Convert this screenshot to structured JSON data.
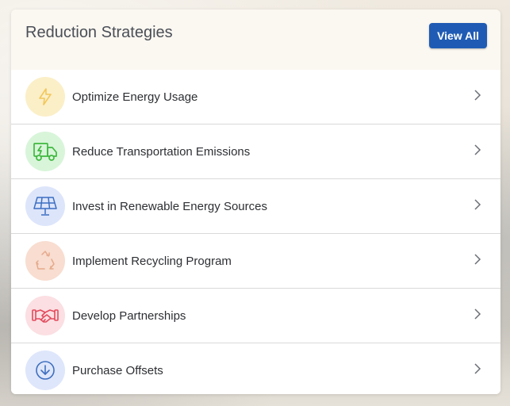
{
  "header": {
    "title": "Reduction Strategies",
    "view_all_label": "View All"
  },
  "items": [
    {
      "label": "Optimize Energy Usage",
      "icon": "lightning-icon",
      "icon_bg": "#fbefc8",
      "icon_color": "#f2c75a"
    },
    {
      "label": "Reduce Transportation Emissions",
      "icon": "electric-truck-icon",
      "icon_bg": "#d8f5da",
      "icon_color": "#3fb83f"
    },
    {
      "label": "Invest in Renewable Energy Sources",
      "icon": "solar-panel-icon",
      "icon_bg": "#dde5fb",
      "icon_color": "#3c6fc2"
    },
    {
      "label": "Implement Recycling Program",
      "icon": "recycle-icon",
      "icon_bg": "#f8ddd0",
      "icon_color": "#e5a98b"
    },
    {
      "label": "Develop Partnerships",
      "icon": "handshake-icon",
      "icon_bg": "#fbdfe2",
      "icon_color": "#e34a5c"
    },
    {
      "label": "Purchase Offsets",
      "icon": "download-icon",
      "icon_bg": "#dee6fb",
      "icon_color": "#3f6fbf"
    }
  ]
}
